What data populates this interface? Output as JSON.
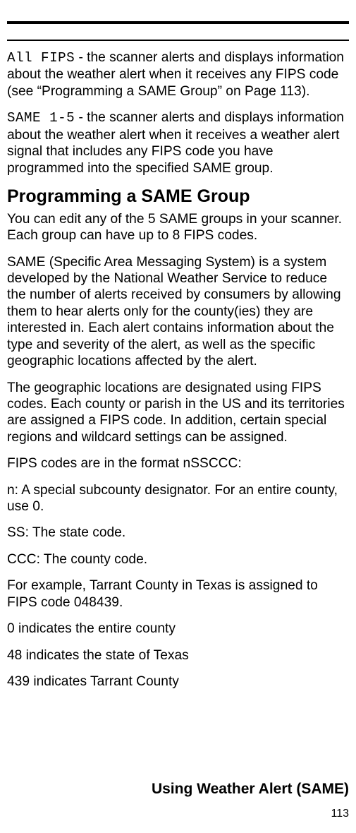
{
  "rules": {},
  "paragraphs": {
    "p1": {
      "mono": "All FIPS",
      "rest": " - the scanner alerts and displays information about the weather alert when it receives any FIPS code (see “Programming a SAME Group” on Page 113)."
    },
    "p2": {
      "mono": "SAME 1-5",
      "rest": " - the scanner alerts and displays information about the weather alert when it receives a weather alert signal that includes any FIPS code you have programmed into the specified SAME group."
    }
  },
  "heading": "Programming a SAME Group",
  "body": {
    "b1": "You can edit any of the 5 SAME groups in your scanner. Each group can have up to 8 FIPS codes.",
    "b2": "SAME (Specific Area Messaging System) is a system developed by the National Weather Service to reduce the number of alerts received by consumers by allowing them to hear alerts only for the county(ies) they are interested in. Each alert contains information about the type and severity of the alert, as well as the specific geographic locations affected by the alert.",
    "b3": "The geographic locations are designated using FIPS codes. Each county or parish in the US and its territories are assigned a FIPS code. In addition, certain special regions and wildcard settings can be assigned.",
    "b4": "FIPS codes are in the format nSSCCC:",
    "b5": "n: A special subcounty designator. For an entire county, use 0.",
    "b6": "SS: The state code.",
    "b7": "CCC: The county code.",
    "b8": "For example, Tarrant County in Texas is assigned to FIPS code 048439.",
    "b9": "0 indicates the entire county",
    "b10": "48 indicates the state of Texas",
    "b11": "439 indicates Tarrant County"
  },
  "footer": {
    "title": "Using Weather Alert (SAME)",
    "page": "113"
  }
}
